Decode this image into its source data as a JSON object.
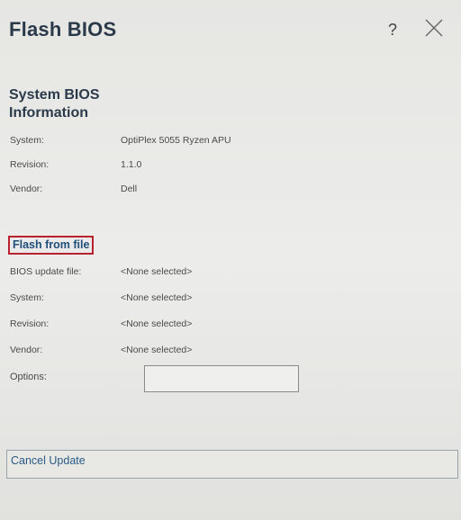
{
  "window": {
    "title": "Flash BIOS",
    "help_icon": "?"
  },
  "system_info": {
    "heading": "System BIOS Information",
    "rows": [
      {
        "label": "System:",
        "value": "OptiPlex 5055 Ryzen APU"
      },
      {
        "label": "Revision:",
        "value": "1.1.0"
      },
      {
        "label": "Vendor:",
        "value": "Dell"
      }
    ]
  },
  "flash": {
    "link_label": "Flash from file",
    "highlight_color": "#b7222e",
    "rows": [
      {
        "label": "BIOS update file:",
        "value": "<None selected>"
      },
      {
        "label": "System:",
        "value": "<None selected>"
      },
      {
        "label": "Revision:",
        "value": "<None selected>"
      },
      {
        "label": "Vendor:",
        "value": "<None selected>"
      }
    ],
    "options_label": "Options:"
  },
  "footer": {
    "cancel_label": "Cancel Update"
  },
  "icons": {
    "help": "help-icon",
    "close": "close-icon"
  }
}
